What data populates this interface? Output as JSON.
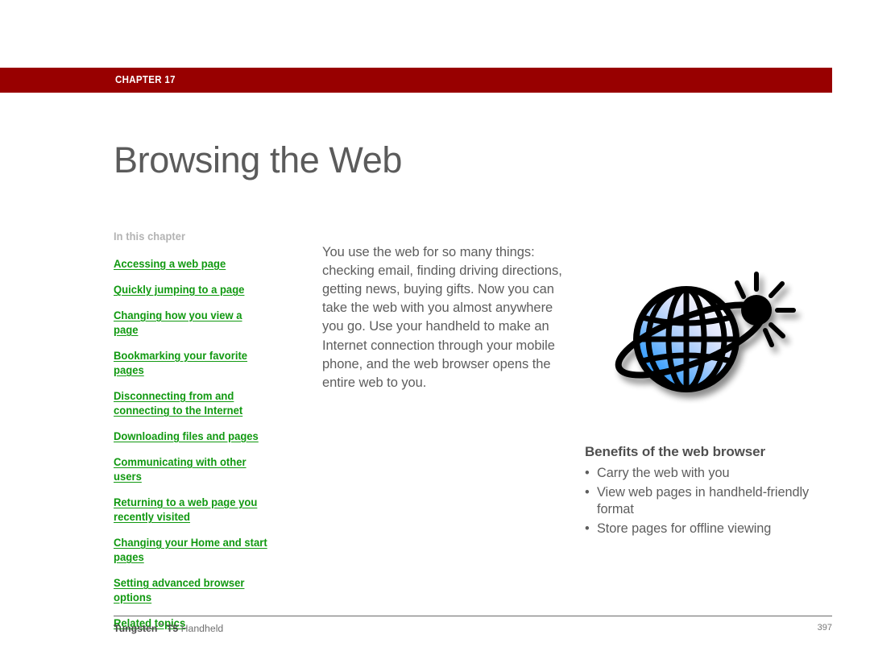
{
  "colors": {
    "chapter_band": "#980000",
    "link_green": "#119911",
    "title_gray": "#5b5b5b",
    "body_gray": "#5d5d5d",
    "heading_gray": "#b3b3b3"
  },
  "header": {
    "chapter_label": "CHAPTER 17",
    "page_title": "Browsing the Web"
  },
  "sidebar": {
    "heading": "In this chapter",
    "links": [
      {
        "label": "Accessing a web page"
      },
      {
        "label": "Quickly jumping to a page"
      },
      {
        "label": "Changing how you view a page"
      },
      {
        "label": "Bookmarking your favorite pages"
      },
      {
        "label": "Disconnecting from and connecting to the Internet"
      },
      {
        "label": "Downloading files and pages"
      },
      {
        "label": "Communicating with other users"
      },
      {
        "label": "Returning to a web page you recently visited"
      },
      {
        "label": "Changing your Home and start pages"
      },
      {
        "label": "Setting advanced browser options"
      },
      {
        "label": "Related topics"
      }
    ]
  },
  "main": {
    "intro": "You use the web for so many things: checking email, finding driving directions, getting news, buying gifts. Now you can take the web with you almost anywhere you go. Use your handheld to make an Internet connection through your mobile phone, and the web browser opens the entire web to you.",
    "illustration": "globe-with-network-node-icon"
  },
  "benefits": {
    "title": "Benefits of the web browser",
    "bullet_char": "•",
    "items": [
      {
        "text": "Carry the web with you"
      },
      {
        "text": "View web pages in handheld-friendly format"
      },
      {
        "text": "Store pages for offline viewing"
      }
    ]
  },
  "footer": {
    "brand": "Tungsten",
    "trademark": "™",
    "model": " T5",
    "product": " Handheld",
    "page_number": "397"
  }
}
